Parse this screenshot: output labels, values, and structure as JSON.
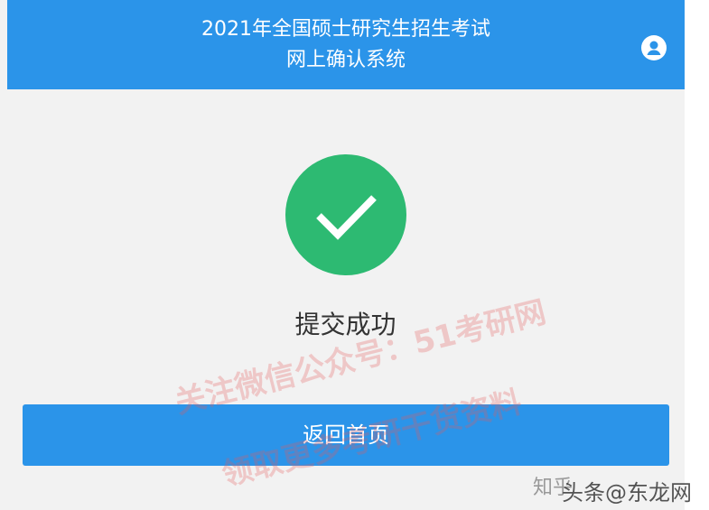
{
  "header": {
    "title_line1": "2021年全国硕士研究生招生考试",
    "title_line2": "网上确认系统",
    "user_icon": "user-circle-icon"
  },
  "main": {
    "status_icon": "check-circle-icon",
    "status_text": "提交成功",
    "home_button_label": "返回首页"
  },
  "watermark": {
    "line1": "关注微信公众号：51考研网",
    "line2": "领取更多考研干货资料",
    "corner_line1": "知乎",
    "corner_line2": "头条@东龙网"
  },
  "colors": {
    "header_bg": "#2b94e9",
    "button_bg": "#2b94e9",
    "success_green": "#2dba72",
    "page_bg": "#f2f2f2"
  }
}
